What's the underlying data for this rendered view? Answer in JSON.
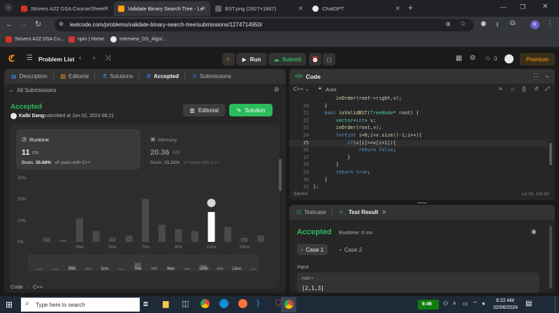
{
  "browser": {
    "tabs": [
      {
        "label": "Strivers A2Z DSA Course/Sheet",
        "fav_color": "#d93025",
        "fav_text": "TUF"
      },
      {
        "label": "Validate Binary Search Tree - Le",
        "fav_color": "#ffa116",
        "fav_text": ""
      },
      {
        "label": "BST.png (2927×1867)",
        "fav_color": "#5f6368",
        "fav_text": ""
      },
      {
        "label": "ChatGPT",
        "fav_color": "#e8eaed",
        "fav_text": ""
      }
    ],
    "url": "leetcode.com/problems/validate-binary-search-tree/submissions/1274714950/",
    "profile_letter": "K",
    "bookmarks": [
      {
        "label": "Strivers A2Z DSA Co...",
        "fav_color": "#d93025"
      },
      {
        "label": "npm | Home",
        "fav_color": "#cb3837"
      },
      {
        "label": "Interview_DS_Algo/...",
        "fav_color": "#e8eaed"
      }
    ]
  },
  "lc": {
    "problem_list": "Problem List",
    "run": "Run",
    "submit": "Submit",
    "fire_count": "0",
    "premium": "Premium"
  },
  "left": {
    "tabs": [
      "Description",
      "Editorial",
      "Solutions",
      "Accepted",
      "Submissions"
    ],
    "all_submissions": "All Submissions",
    "status": "Accepted",
    "user": "Kalki Dang",
    "submitted": "submitted at Jun 02, 2024 08:21",
    "editorial_btn": "Editorial",
    "solution_btn": "Solution",
    "runtime_title": "Runtime",
    "runtime_value": "11",
    "runtime_unit": "ms",
    "runtime_beats_prefix": "Beats",
    "runtime_beats": "35.68%",
    "runtime_beats_suffix": "of users with C++",
    "memory_title": "Memory",
    "memory_value": "20.36",
    "memory_unit": "MB",
    "memory_beats_prefix": "Beats",
    "memory_beats": "15.32%",
    "memory_beats_suffix": "of users with C++",
    "code_label": "Code",
    "lang_label": "C++"
  },
  "chart_data": {
    "type": "bar",
    "yticks": [
      "30%",
      "20%",
      "10%",
      "0%"
    ],
    "ylim": [
      0,
      30
    ],
    "xlabels": [
      "3ms",
      "5ms",
      "7ms",
      "9ms",
      "11ms",
      "13ms"
    ],
    "values": [
      2,
      1,
      11,
      5,
      2,
      3,
      20,
      8,
      6,
      5,
      14,
      7,
      2,
      3
    ],
    "highlight_index": 10,
    "mini_xlabels": [
      "3ms",
      "5ms",
      "7ms",
      "9ms",
      "11ms",
      "13ms"
    ]
  },
  "code": {
    "title": "Code",
    "lang": "C++",
    "auto": "Auto",
    "lines": [
      {
        "n": "",
        "text": "        inOrder(root->right,v);"
      },
      {
        "n": "20",
        "text": "    }"
      },
      {
        "n": "21",
        "text": "    bool isValidBST(TreeNode* root) {"
      },
      {
        "n": "22",
        "text": "        vector<int> v;"
      },
      {
        "n": "23",
        "text": "        inOrder(root,v);"
      },
      {
        "n": "24",
        "text": "        for(int i=0;i<v.size()-1;i++){"
      },
      {
        "n": "25",
        "text": "            if(v[i]>=v[i+1]){"
      },
      {
        "n": "26",
        "text": "                return false;"
      },
      {
        "n": "27",
        "text": "            }"
      },
      {
        "n": "28",
        "text": "        }"
      },
      {
        "n": "29",
        "text": "        return true;"
      },
      {
        "n": "30",
        "text": "    }"
      },
      {
        "n": "31",
        "text": "};"
      }
    ],
    "saved": "Saved",
    "cursor": "Ln 25, Col 33"
  },
  "result": {
    "testcase_tab": "Testcase",
    "result_tab": "Test Result",
    "status": "Accepted",
    "runtime": "Runtime: 0 ms",
    "case1": "Case 1",
    "case2": "Case 2",
    "input_label": "Input",
    "var_label": "root =",
    "var_value": "[2,1,3]"
  },
  "taskbar": {
    "search_placeholder": "Type here to search",
    "battery": "6:46",
    "time": "8:22 AM",
    "date": "02/06/2024"
  }
}
